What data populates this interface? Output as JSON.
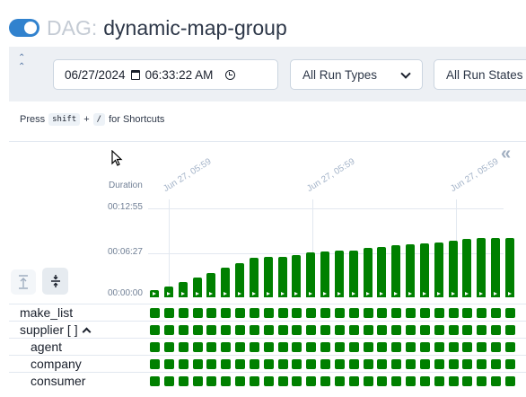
{
  "header": {
    "toggle_on": true,
    "title_prefix": "DAG:",
    "dag_name": "dynamic-map-group"
  },
  "filters": {
    "date": "06/27/2024",
    "time": "06:33:22 AM",
    "run_types": "All Run Types",
    "run_states": "All Run States"
  },
  "hint": {
    "press": "Press",
    "key1": "shift",
    "plus": "+",
    "key2": "/",
    "suffix": "for Shortcuts"
  },
  "chart_data": {
    "type": "bar",
    "ylabel": "Duration",
    "yticks": [
      "00:12:55",
      "00:06:27",
      "00:00:00"
    ],
    "x_date_labels": [
      "Jun 27, 05:59",
      "Jun 27, 05:59",
      "Jun 27, 05:59"
    ],
    "y_max_seconds": 775,
    "values_seconds": [
      60,
      95,
      130,
      175,
      215,
      255,
      300,
      345,
      350,
      355,
      365,
      390,
      400,
      410,
      410,
      430,
      440,
      455,
      460,
      470,
      480,
      490,
      505,
      515,
      520,
      515
    ],
    "color": "#008000"
  },
  "tasks": [
    {
      "label": "make_list",
      "indent": false
    },
    {
      "label": "supplier [ ]",
      "indent": false,
      "expanded": true
    },
    {
      "label": "agent",
      "indent": true
    },
    {
      "label": "company",
      "indent": true
    },
    {
      "label": "consumer",
      "indent": true
    }
  ],
  "status_color": "#008000"
}
